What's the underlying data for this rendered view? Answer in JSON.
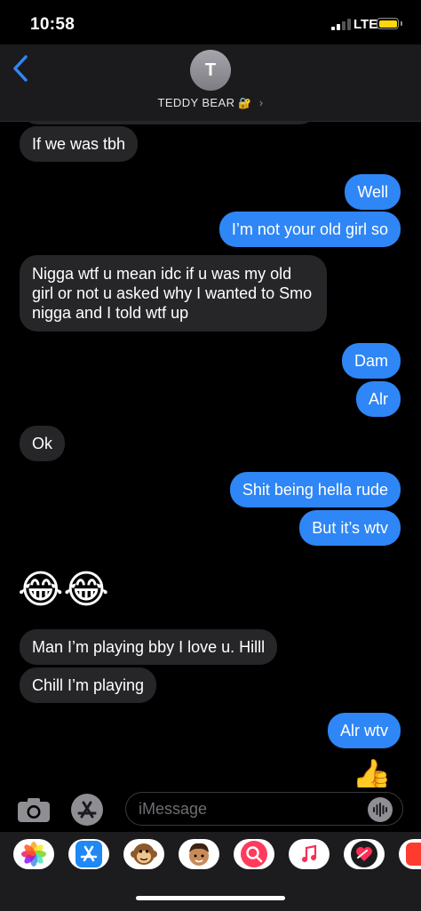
{
  "status_bar": {
    "time": "10:58",
    "network": "LTE"
  },
  "header": {
    "avatar_initial": "T",
    "contact_name": "TEDDY BEAR",
    "contact_emoji": "🔐",
    "chevron": "›"
  },
  "messages": [
    {
      "dir": "in",
      "text": "If we was tbh"
    },
    {
      "dir": "out",
      "text": "Well"
    },
    {
      "dir": "out",
      "text": "I’m not your old girl so"
    },
    {
      "dir": "in",
      "text": "Nigga wtf u mean idc if u was my old girl  or not u asked why I wanted to Smo nigga and I told wtf up"
    },
    {
      "dir": "out",
      "text": "Dam"
    },
    {
      "dir": "out",
      "text": "Alr"
    },
    {
      "dir": "in",
      "text": "Ok"
    },
    {
      "dir": "out",
      "text": "Shit being hella rude"
    },
    {
      "dir": "out",
      "text": "But it’s wtv"
    },
    {
      "dir": "in",
      "text": "😂😂"
    },
    {
      "dir": "in",
      "text": "Man I’m playing bby I love u. Hilll"
    },
    {
      "dir": "in",
      "text": "Chill I’m playing"
    },
    {
      "dir": "out",
      "text": "Alr wtv"
    }
  ],
  "tapback_emoji": "👍",
  "input": {
    "placeholder": "iMessage"
  },
  "app_drawer": [
    "photos-icon",
    "app-store-icon",
    "animoji-icon",
    "memoji-icon",
    "images-search-icon",
    "music-icon",
    "digital-touch-icon",
    "more-app-icon"
  ],
  "colors": {
    "outgoing": "#2f86f6",
    "incoming": "#262628",
    "accent": "#2f86f6"
  }
}
